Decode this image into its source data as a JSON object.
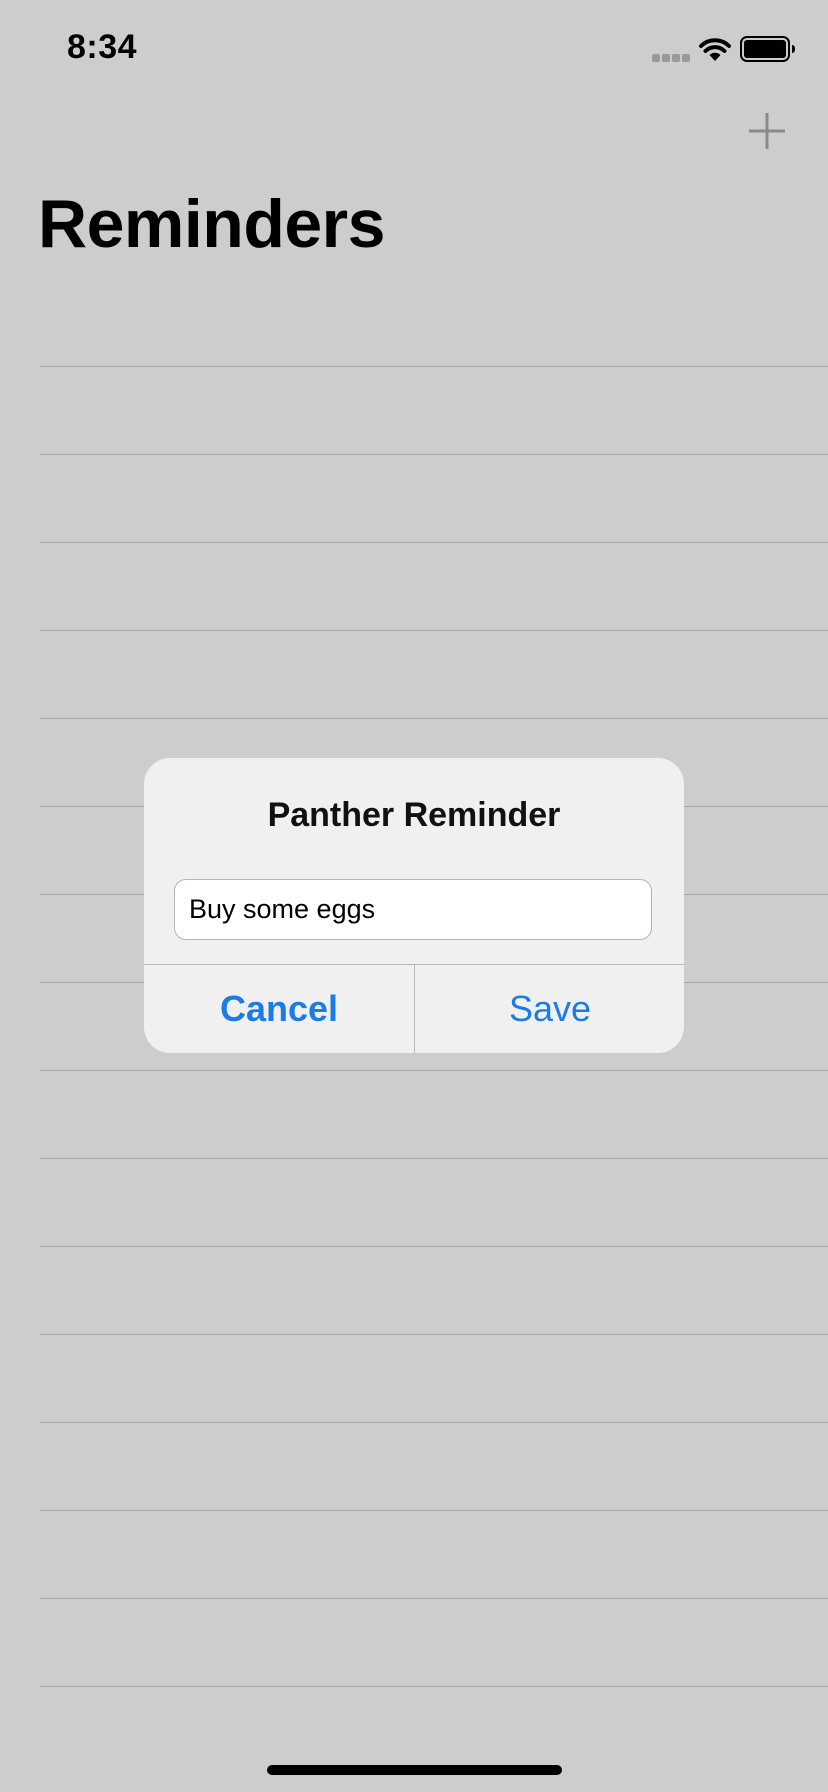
{
  "status_bar": {
    "time": "8:34"
  },
  "nav": {
    "add_icon": "plus-icon"
  },
  "page": {
    "title": "Reminders"
  },
  "dialog": {
    "title": "Panther Reminder",
    "input_value": "Buy some eggs",
    "cancel_label": "Cancel",
    "save_label": "Save"
  },
  "colors": {
    "background": "#cdcdcd",
    "dialog_background": "#f0f0f0",
    "accent": "#1a7ce6",
    "separator": "#a8a8a8"
  }
}
